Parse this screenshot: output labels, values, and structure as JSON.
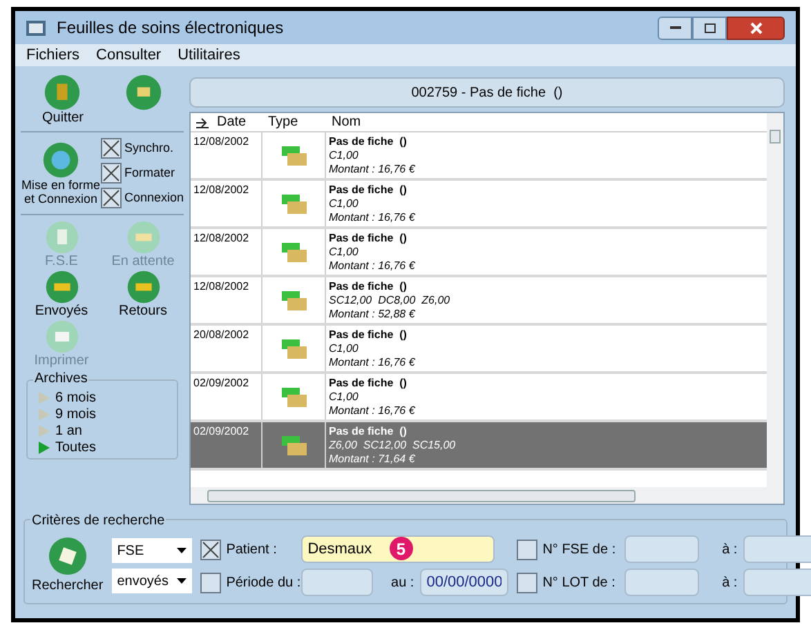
{
  "window": {
    "title": "Feuilles de soins électroniques"
  },
  "menu": [
    "Fichiers",
    "Consulter",
    "Utilitaires"
  ],
  "toolbar": {
    "quit": {
      "label": "Quitter"
    },
    "mise": {
      "label": "Mise en forme et Connexion"
    },
    "options": [
      {
        "label": "Synchro.",
        "checked": true
      },
      {
        "label": "Formater",
        "checked": true
      },
      {
        "label": "Connexion",
        "checked": true
      }
    ],
    "actions": [
      {
        "label": "F.S.E",
        "disabled": true,
        "kind": "doc"
      },
      {
        "label": "En attente",
        "disabled": true,
        "kind": "tray"
      },
      {
        "label": "Envoyés",
        "disabled": false,
        "kind": "tray"
      },
      {
        "label": "Retours",
        "disabled": false,
        "kind": "tray"
      },
      {
        "label": "Imprimer",
        "disabled": true,
        "kind": "printer"
      }
    ],
    "archives": {
      "title": "Archives",
      "items": [
        {
          "label": "6 mois",
          "selected": false
        },
        {
          "label": "9 mois",
          "selected": false
        },
        {
          "label": "1 an",
          "selected": false
        },
        {
          "label": "Toutes",
          "selected": true
        }
      ]
    }
  },
  "header": "002759 - Pas de fiche  ()",
  "table": {
    "columns": [
      "Date",
      "Type",
      "Nom"
    ],
    "rows": [
      {
        "date": "12/08/2002",
        "name": "Pas de fiche  ()",
        "acts": "C1,00",
        "amount": "Montant : 16,76 €",
        "selected": false
      },
      {
        "date": "12/08/2002",
        "name": "Pas de fiche  ()",
        "acts": "C1,00",
        "amount": "Montant : 16,76 €",
        "selected": false
      },
      {
        "date": "12/08/2002",
        "name": "Pas de fiche  ()",
        "acts": "C1,00",
        "amount": "Montant : 16,76 €",
        "selected": false
      },
      {
        "date": "12/08/2002",
        "name": "Pas de fiche  ()",
        "acts": "SC12,00  DC8,00  Z6,00",
        "amount": "Montant : 52,88 €",
        "selected": false
      },
      {
        "date": "20/08/2002",
        "name": "Pas de fiche  ()",
        "acts": "C1,00",
        "amount": "Montant : 16,76 €",
        "selected": false
      },
      {
        "date": "02/09/2002",
        "name": "Pas de fiche  ()",
        "acts": "C1,00",
        "amount": "Montant : 16,76 €",
        "selected": false
      },
      {
        "date": "02/09/2002",
        "name": "Pas de fiche  ()",
        "acts": "Z6,00  SC12,00  SC15,00",
        "amount": "Montant : 71,64 €",
        "selected": true
      }
    ]
  },
  "search": {
    "title": "Critères de recherche",
    "button": "Rechercher",
    "type": "FSE",
    "status": "envoyés",
    "patient": {
      "label": "Patient :",
      "checked": true,
      "value": "Desmaux"
    },
    "badge": "5",
    "period": {
      "label": "Période du :",
      "checked": false,
      "to_label": "au :",
      "to_value": "00/00/0000"
    },
    "fse": {
      "label": "N° FSE de :",
      "checked": false,
      "to_label": "à :"
    },
    "lot": {
      "label": "N° LOT de :",
      "checked": false,
      "to_label": "à :"
    }
  }
}
